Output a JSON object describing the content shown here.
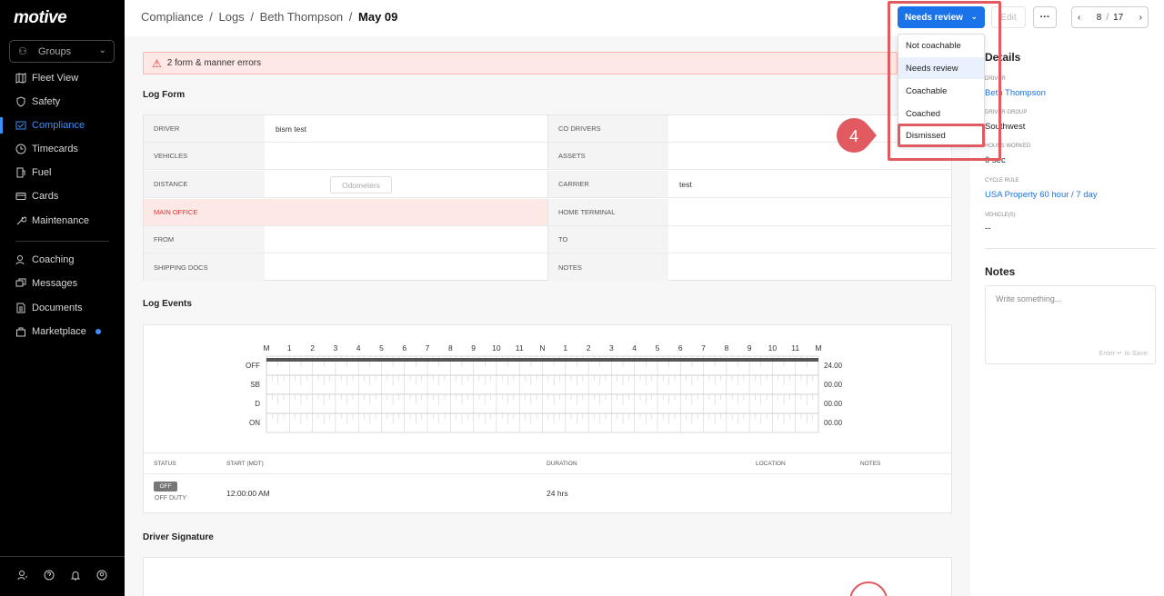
{
  "sidebar": {
    "logo": "motive",
    "groups_label": "Groups",
    "items": [
      {
        "label": "Fleet View"
      },
      {
        "label": "Safety"
      },
      {
        "label": "Compliance"
      },
      {
        "label": "Timecards"
      },
      {
        "label": "Fuel"
      },
      {
        "label": "Cards"
      },
      {
        "label": "Maintenance"
      },
      {
        "label": "Coaching"
      },
      {
        "label": "Messages"
      },
      {
        "label": "Documents"
      },
      {
        "label": "Marketplace"
      }
    ],
    "active": "Compliance"
  },
  "header": {
    "breadcrumb": [
      "Compliance",
      "/",
      "Logs",
      "/",
      "Beth Thompson",
      "/",
      "May 09"
    ],
    "status_button": "Needs review",
    "edit_button": "Edit",
    "more_button": "···",
    "pager": {
      "current": "8",
      "sep": "/",
      "total": "17"
    }
  },
  "dropdown": {
    "options": [
      "Not coachable",
      "Needs review",
      "Coachable",
      "Coached",
      "Dismissed"
    ],
    "selected": "Needs review",
    "highlighted": "Dismissed",
    "step_number": "4"
  },
  "banner": {
    "text": "2 form & manner errors"
  },
  "log_form": {
    "title": "Log Form",
    "rows": [
      {
        "l1": "DRIVER",
        "v1": "bism test",
        "l2": "CO DRIVERS",
        "v2": ""
      },
      {
        "l1": "VEHICLES",
        "v1": "",
        "l2": "ASSETS",
        "v2": ""
      },
      {
        "l1": "DISTANCE",
        "v1": "",
        "l2": "CARRIER",
        "v2": "test"
      },
      {
        "l1": "MAIN OFFICE",
        "v1": "",
        "l2": "HOME TERMINAL",
        "v2": ""
      },
      {
        "l1": "FROM",
        "v1": "",
        "l2": "TO",
        "v2": ""
      },
      {
        "l1": "SHIPPING DOCS",
        "v1": "",
        "l2": "NOTES",
        "v2": ""
      }
    ],
    "odometers_button": "Odometers"
  },
  "log_events": {
    "title": "Log Events",
    "hours": [
      "M",
      "1",
      "2",
      "3",
      "4",
      "5",
      "6",
      "7",
      "8",
      "9",
      "10",
      "11",
      "N",
      "1",
      "2",
      "3",
      "4",
      "5",
      "6",
      "7",
      "8",
      "9",
      "10",
      "11",
      "M"
    ],
    "rows": [
      {
        "label": "OFF",
        "total": "24.00"
      },
      {
        "label": "SB",
        "total": "00.00"
      },
      {
        "label": "D",
        "total": "00.00"
      },
      {
        "label": "ON",
        "total": "00.00"
      }
    ],
    "columns": [
      "STATUS",
      "START (MDT)",
      "DURATION",
      "LOCATION",
      "NOTES"
    ],
    "event": {
      "badge": "OFF",
      "status": "OFF DUTY",
      "start": "12:00:00 AM",
      "duration": "24 hrs"
    }
  },
  "signature": {
    "title": "Driver Signature"
  },
  "details": {
    "title": "Details",
    "fields": [
      {
        "label": "DRIVER",
        "value": "Beth Thompson",
        "link": true
      },
      {
        "label": "DRIVER GROUP",
        "value": "Southwest",
        "link": false
      },
      {
        "label": "HOURS WORKED",
        "value": "0 sec",
        "link": false
      },
      {
        "label": "CYCLE RULE",
        "value": "USA Property 60 hour / 7 day",
        "link": true
      },
      {
        "label": "VEHICLE(S)",
        "value": "--",
        "link": false
      }
    ]
  },
  "notes": {
    "title": "Notes",
    "placeholder": "Write something...",
    "hint": "Enter ↵ to Save"
  },
  "colors": {
    "accent": "#1a73e8",
    "sidebar_bg": "#000000",
    "error": "#d33333",
    "highlight": "#e05a5f"
  }
}
